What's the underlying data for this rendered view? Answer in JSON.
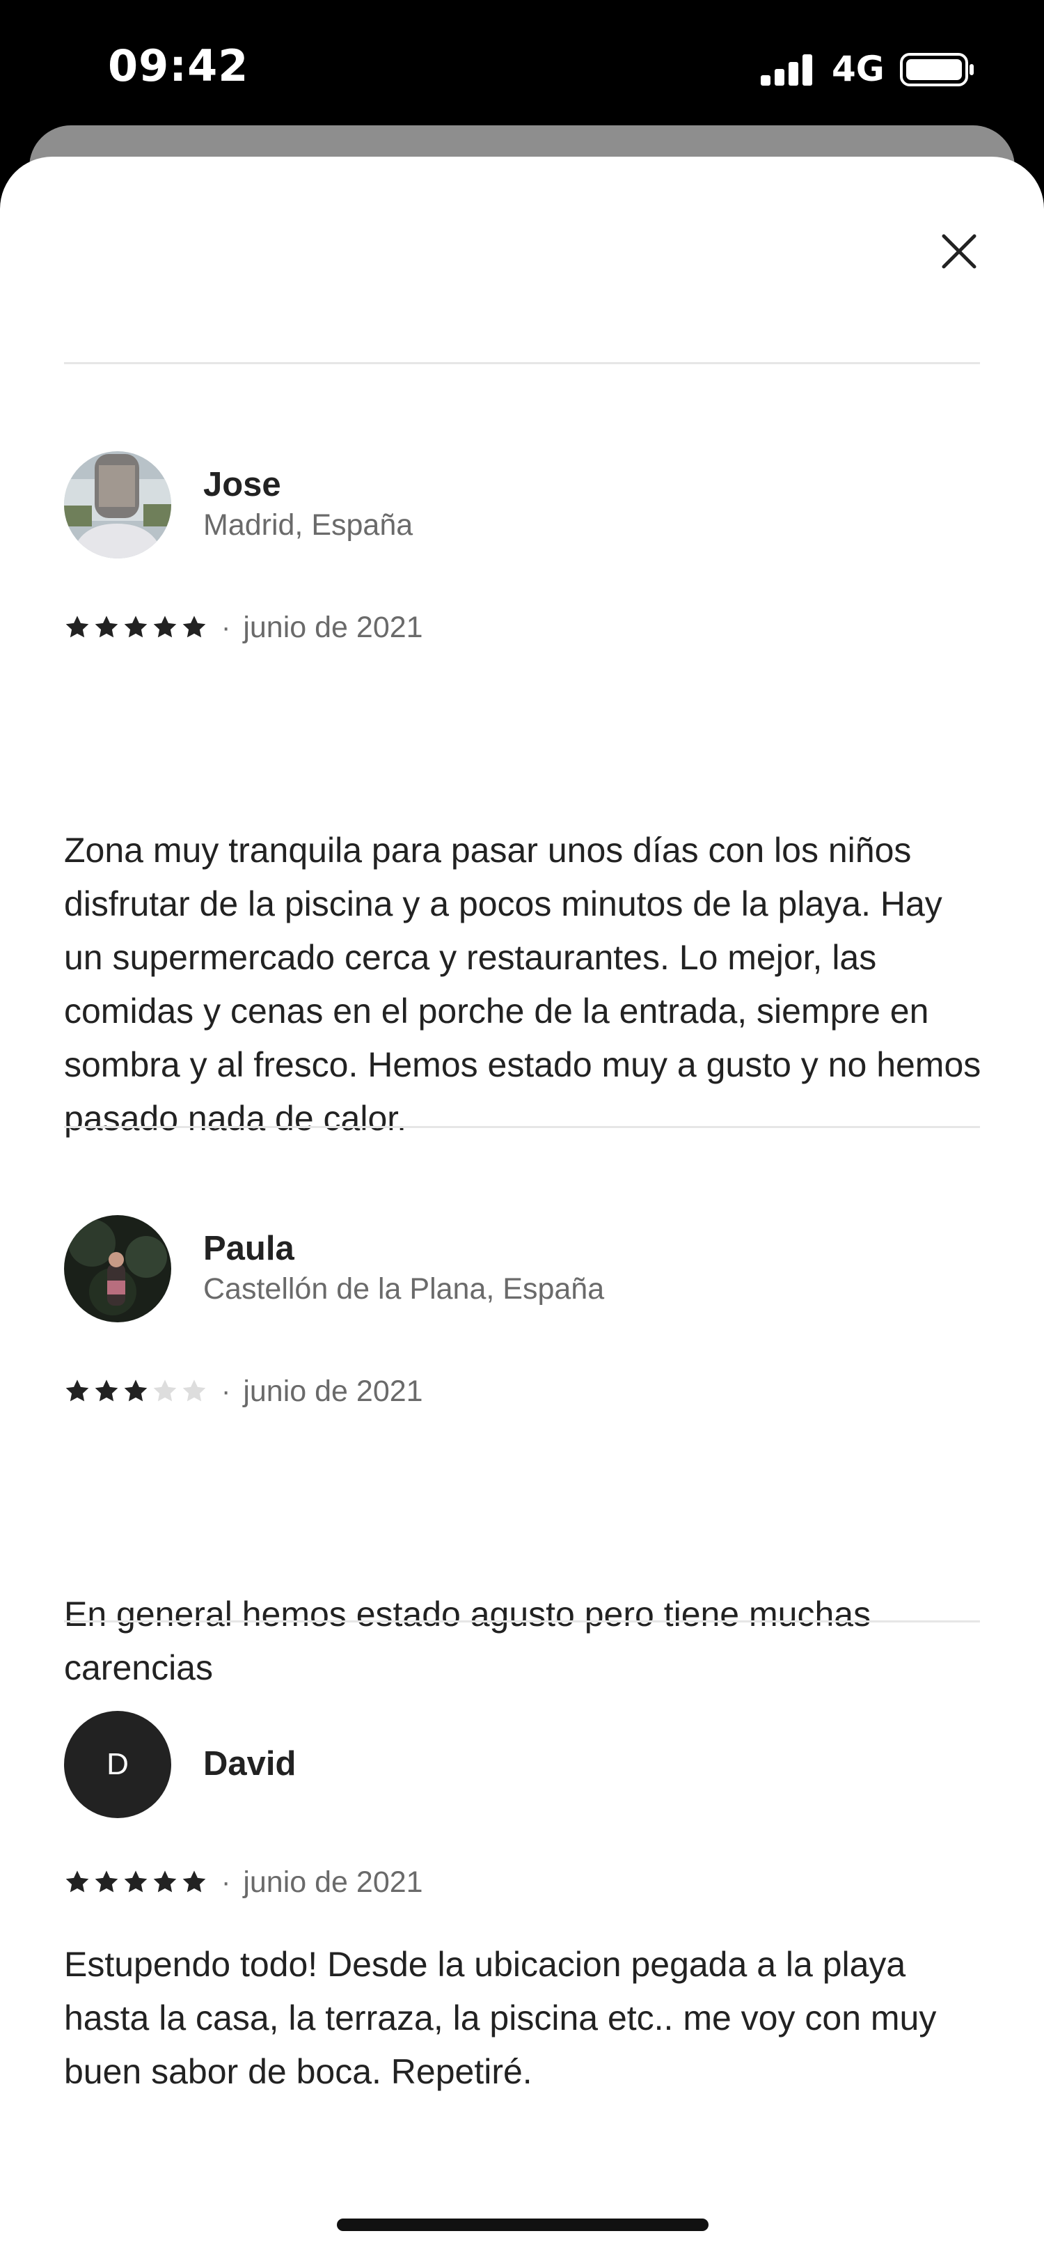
{
  "status_bar": {
    "time": "09:42",
    "network": "4G"
  },
  "colors": {
    "star_filled": "#222222",
    "star_empty": "#dddddd",
    "divider": "#e6e6e6",
    "secondary_text": "#6a6a6a"
  },
  "reviews": [
    {
      "name": "Jose",
      "location": "Madrid, España",
      "rating": 5,
      "date": "junio de 2021",
      "text": "Zona muy tranquila para pasar unos días con los niños disfrutar de la piscina y a pocos minutos de la playa. Hay un supermercado cerca y restaurantes. Lo mejor, las comidas y cenas en el porche de la entrada, siempre en sombra y al fresco. Hemos estado muy a gusto y no hemos pasado nada de calor."
    },
    {
      "name": "Paula",
      "location": "Castellón de la Plana, España",
      "rating": 3,
      "date": "junio de 2021",
      "text": "En general hemos estado agusto pero tiene muchas carencias"
    },
    {
      "name": "David",
      "avatar_initial": "D",
      "rating": 5,
      "date": "junio de 2021",
      "text": "Estupendo todo! Desde la ubicacion pegada a la playa hasta la casa, la terraza, la piscina etc.. me voy con muy buen sabor de boca. Repetiré."
    }
  ]
}
